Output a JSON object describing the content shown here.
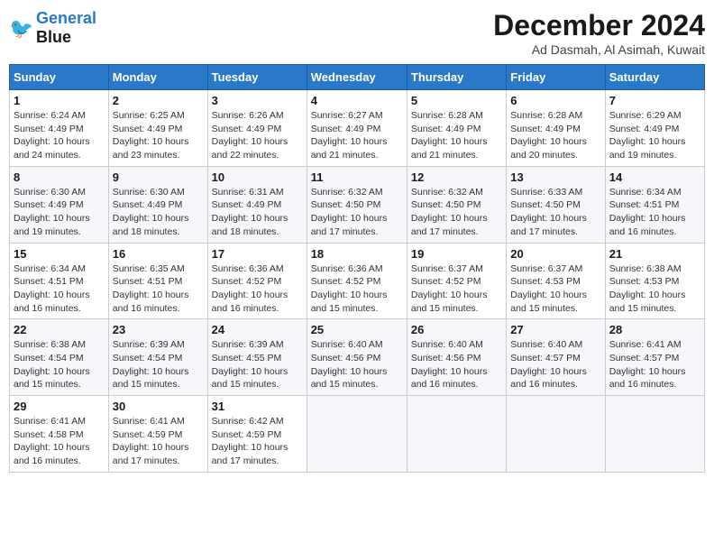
{
  "logo": {
    "text1": "General",
    "text2": "Blue"
  },
  "title": "December 2024",
  "location": "Ad Dasmah, Al Asimah, Kuwait",
  "weekdays": [
    "Sunday",
    "Monday",
    "Tuesday",
    "Wednesday",
    "Thursday",
    "Friday",
    "Saturday"
  ],
  "weeks": [
    [
      {
        "day": "1",
        "info": "Sunrise: 6:24 AM\nSunset: 4:49 PM\nDaylight: 10 hours\nand 24 minutes."
      },
      {
        "day": "2",
        "info": "Sunrise: 6:25 AM\nSunset: 4:49 PM\nDaylight: 10 hours\nand 23 minutes."
      },
      {
        "day": "3",
        "info": "Sunrise: 6:26 AM\nSunset: 4:49 PM\nDaylight: 10 hours\nand 22 minutes."
      },
      {
        "day": "4",
        "info": "Sunrise: 6:27 AM\nSunset: 4:49 PM\nDaylight: 10 hours\nand 21 minutes."
      },
      {
        "day": "5",
        "info": "Sunrise: 6:28 AM\nSunset: 4:49 PM\nDaylight: 10 hours\nand 21 minutes."
      },
      {
        "day": "6",
        "info": "Sunrise: 6:28 AM\nSunset: 4:49 PM\nDaylight: 10 hours\nand 20 minutes."
      },
      {
        "day": "7",
        "info": "Sunrise: 6:29 AM\nSunset: 4:49 PM\nDaylight: 10 hours\nand 19 minutes."
      }
    ],
    [
      {
        "day": "8",
        "info": "Sunrise: 6:30 AM\nSunset: 4:49 PM\nDaylight: 10 hours\nand 19 minutes."
      },
      {
        "day": "9",
        "info": "Sunrise: 6:30 AM\nSunset: 4:49 PM\nDaylight: 10 hours\nand 18 minutes."
      },
      {
        "day": "10",
        "info": "Sunrise: 6:31 AM\nSunset: 4:49 PM\nDaylight: 10 hours\nand 18 minutes."
      },
      {
        "day": "11",
        "info": "Sunrise: 6:32 AM\nSunset: 4:50 PM\nDaylight: 10 hours\nand 17 minutes."
      },
      {
        "day": "12",
        "info": "Sunrise: 6:32 AM\nSunset: 4:50 PM\nDaylight: 10 hours\nand 17 minutes."
      },
      {
        "day": "13",
        "info": "Sunrise: 6:33 AM\nSunset: 4:50 PM\nDaylight: 10 hours\nand 17 minutes."
      },
      {
        "day": "14",
        "info": "Sunrise: 6:34 AM\nSunset: 4:51 PM\nDaylight: 10 hours\nand 16 minutes."
      }
    ],
    [
      {
        "day": "15",
        "info": "Sunrise: 6:34 AM\nSunset: 4:51 PM\nDaylight: 10 hours\nand 16 minutes."
      },
      {
        "day": "16",
        "info": "Sunrise: 6:35 AM\nSunset: 4:51 PM\nDaylight: 10 hours\nand 16 minutes."
      },
      {
        "day": "17",
        "info": "Sunrise: 6:36 AM\nSunset: 4:52 PM\nDaylight: 10 hours\nand 16 minutes."
      },
      {
        "day": "18",
        "info": "Sunrise: 6:36 AM\nSunset: 4:52 PM\nDaylight: 10 hours\nand 15 minutes."
      },
      {
        "day": "19",
        "info": "Sunrise: 6:37 AM\nSunset: 4:52 PM\nDaylight: 10 hours\nand 15 minutes."
      },
      {
        "day": "20",
        "info": "Sunrise: 6:37 AM\nSunset: 4:53 PM\nDaylight: 10 hours\nand 15 minutes."
      },
      {
        "day": "21",
        "info": "Sunrise: 6:38 AM\nSunset: 4:53 PM\nDaylight: 10 hours\nand 15 minutes."
      }
    ],
    [
      {
        "day": "22",
        "info": "Sunrise: 6:38 AM\nSunset: 4:54 PM\nDaylight: 10 hours\nand 15 minutes."
      },
      {
        "day": "23",
        "info": "Sunrise: 6:39 AM\nSunset: 4:54 PM\nDaylight: 10 hours\nand 15 minutes."
      },
      {
        "day": "24",
        "info": "Sunrise: 6:39 AM\nSunset: 4:55 PM\nDaylight: 10 hours\nand 15 minutes."
      },
      {
        "day": "25",
        "info": "Sunrise: 6:40 AM\nSunset: 4:56 PM\nDaylight: 10 hours\nand 15 minutes."
      },
      {
        "day": "26",
        "info": "Sunrise: 6:40 AM\nSunset: 4:56 PM\nDaylight: 10 hours\nand 16 minutes."
      },
      {
        "day": "27",
        "info": "Sunrise: 6:40 AM\nSunset: 4:57 PM\nDaylight: 10 hours\nand 16 minutes."
      },
      {
        "day": "28",
        "info": "Sunrise: 6:41 AM\nSunset: 4:57 PM\nDaylight: 10 hours\nand 16 minutes."
      }
    ],
    [
      {
        "day": "29",
        "info": "Sunrise: 6:41 AM\nSunset: 4:58 PM\nDaylight: 10 hours\nand 16 minutes."
      },
      {
        "day": "30",
        "info": "Sunrise: 6:41 AM\nSunset: 4:59 PM\nDaylight: 10 hours\nand 17 minutes."
      },
      {
        "day": "31",
        "info": "Sunrise: 6:42 AM\nSunset: 4:59 PM\nDaylight: 10 hours\nand 17 minutes."
      },
      {
        "day": "",
        "info": ""
      },
      {
        "day": "",
        "info": ""
      },
      {
        "day": "",
        "info": ""
      },
      {
        "day": "",
        "info": ""
      }
    ]
  ]
}
